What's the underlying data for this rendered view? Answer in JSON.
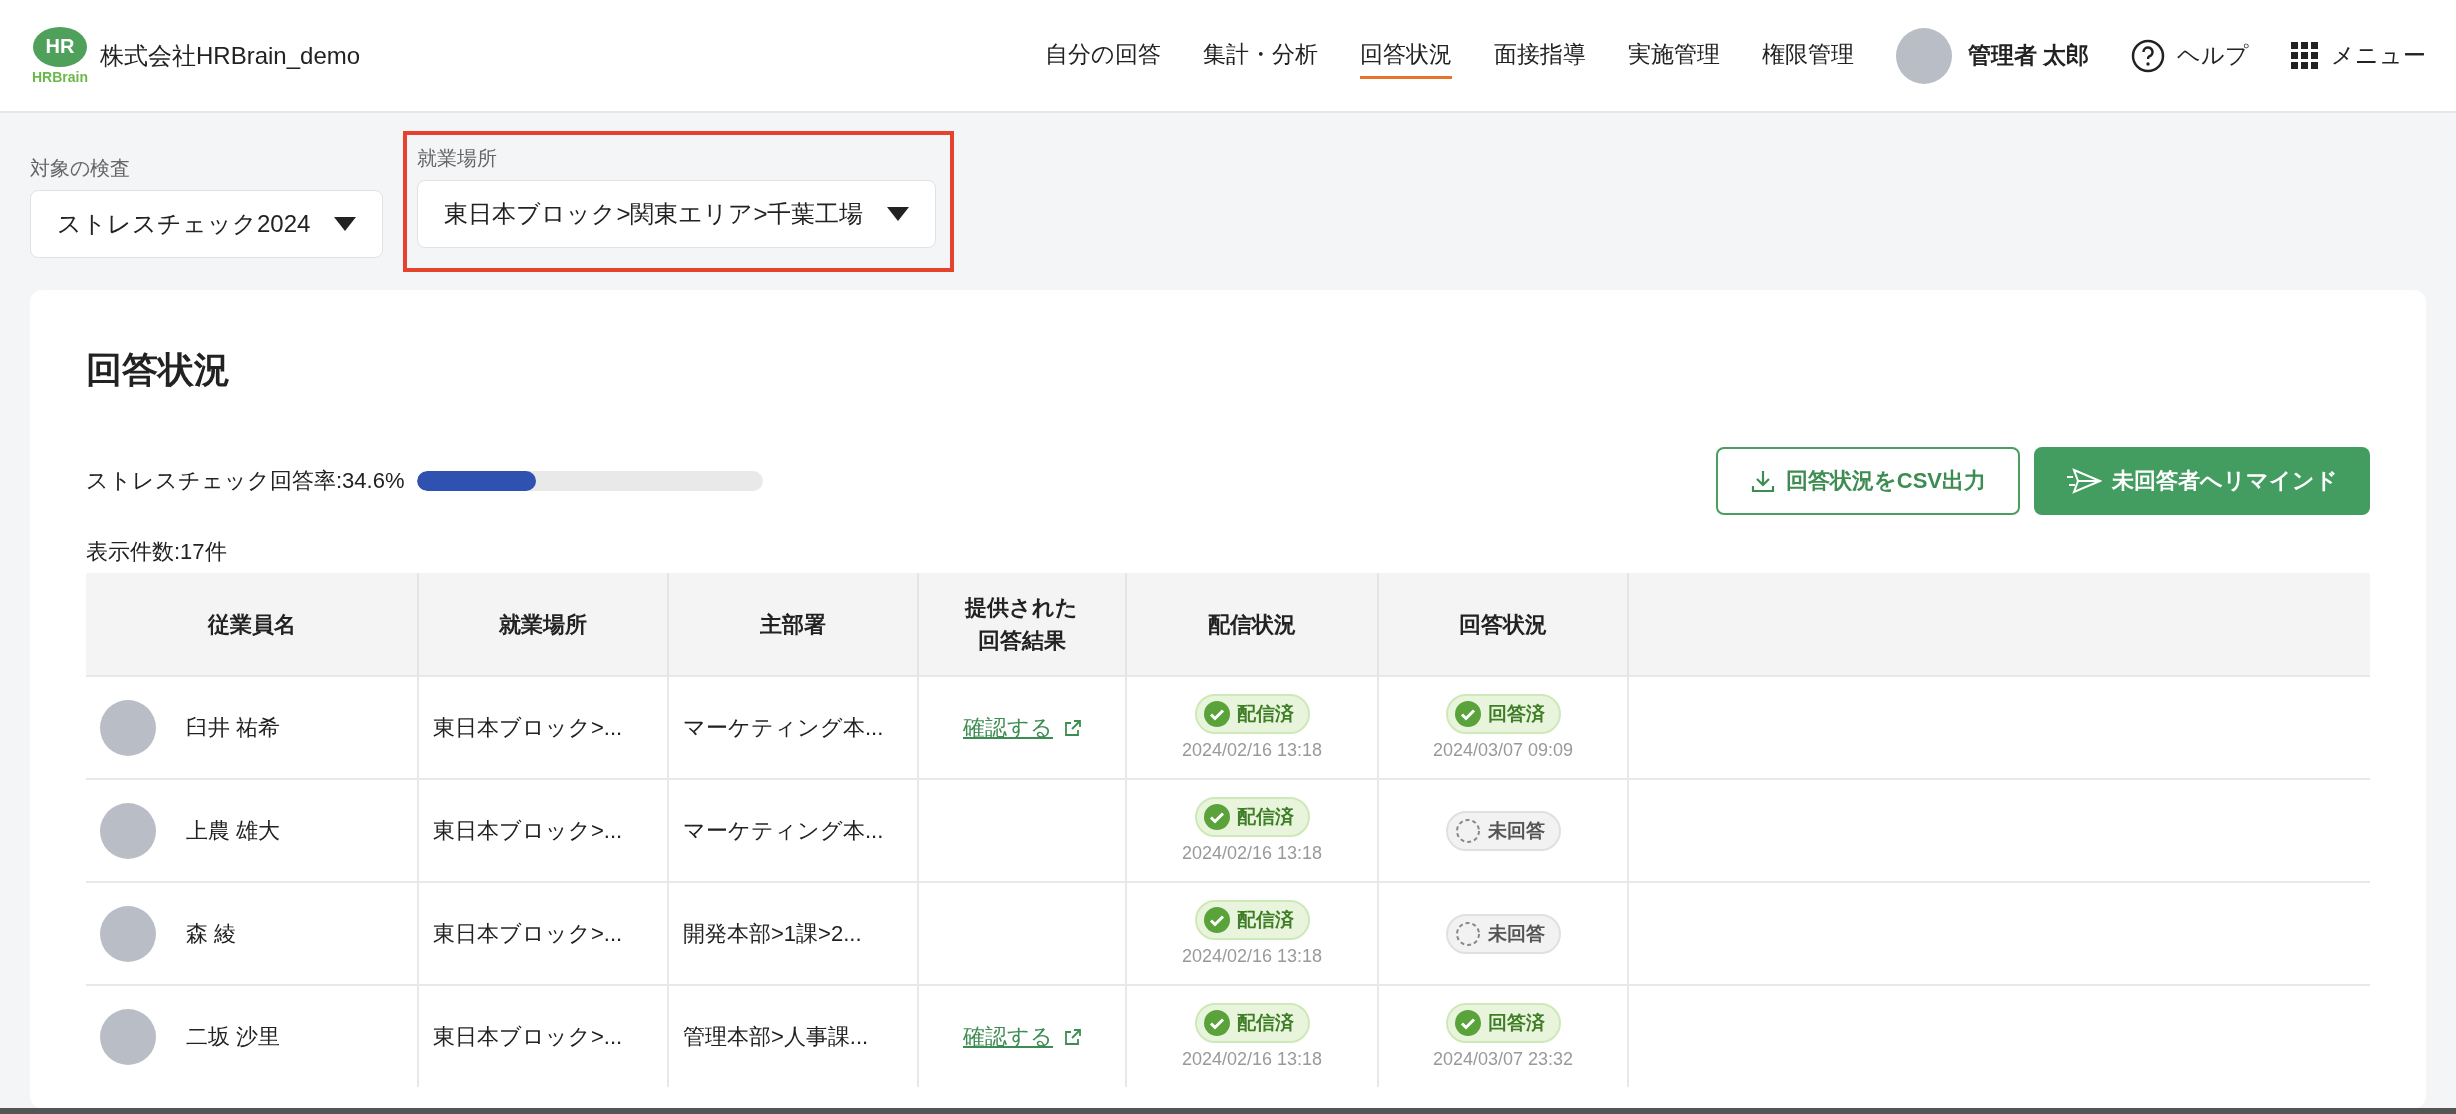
{
  "header": {
    "logo_mark": "HR",
    "logo_word": "HRBrain",
    "company": "株式会社HRBrain_demo",
    "nav": [
      {
        "label": "自分の回答",
        "selected": false
      },
      {
        "label": "集計・分析",
        "selected": false
      },
      {
        "label": "回答状況",
        "selected": true
      },
      {
        "label": "面接指導",
        "selected": false
      },
      {
        "label": "実施管理",
        "selected": false
      },
      {
        "label": "権限管理",
        "selected": false
      }
    ],
    "user": "管理者 太郎",
    "help": "ヘルプ",
    "menu": "メニュー"
  },
  "filters": [
    {
      "label": "対象の検査",
      "value": "ストレスチェック2024",
      "highlighted": false
    },
    {
      "label": "就業場所",
      "value": "東日本ブロック>関東エリア>千葉工場",
      "highlighted": true
    }
  ],
  "card": {
    "title": "回答状況",
    "rate_label": "ストレスチェック回答率:34.6%",
    "rate": {
      "level": 0.346
    },
    "csv_button": "回答状況をCSV出力",
    "remind_button": "未回答者へリマインド",
    "count": "表示件数:17件",
    "table": {
      "columns": [
        "従業員名",
        "就業場所",
        "主部署",
        "提供された回答結果",
        "配信状況",
        "回答状況"
      ],
      "rows": [
        {
          "name": "臼井 祐希",
          "place": "東日本ブロック>...",
          "dept": "マーケティング本...",
          "link": "確認する",
          "delivery": {
            "label": "配信済",
            "done": true,
            "date": "2024/02/16 13:18"
          },
          "answer": {
            "label": "回答済",
            "done": true,
            "date": "2024/03/07 09:09"
          }
        },
        {
          "name": "上農 雄大",
          "place": "東日本ブロック>...",
          "dept": "マーケティング本...",
          "delivery": {
            "label": "配信済",
            "done": true,
            "date": "2024/02/16 13:18"
          },
          "answer": {
            "label": "未回答",
            "done": false
          }
        },
        {
          "name": "森 綾",
          "place": "東日本ブロック>...",
          "dept": "開発本部>1課>2...",
          "delivery": {
            "label": "配信済",
            "done": true,
            "date": "2024/02/16 13:18"
          },
          "answer": {
            "label": "未回答",
            "done": false
          }
        },
        {
          "name": "二坂 沙里",
          "place": "東日本ブロック>...",
          "dept": "管理本部>人事課...",
          "link": "確認する",
          "delivery": {
            "label": "配信済",
            "done": true,
            "date": "2024/02/16 13:18"
          },
          "answer": {
            "label": "回答済",
            "done": true,
            "date": "2024/03/07 23:32"
          }
        }
      ]
    }
  }
}
